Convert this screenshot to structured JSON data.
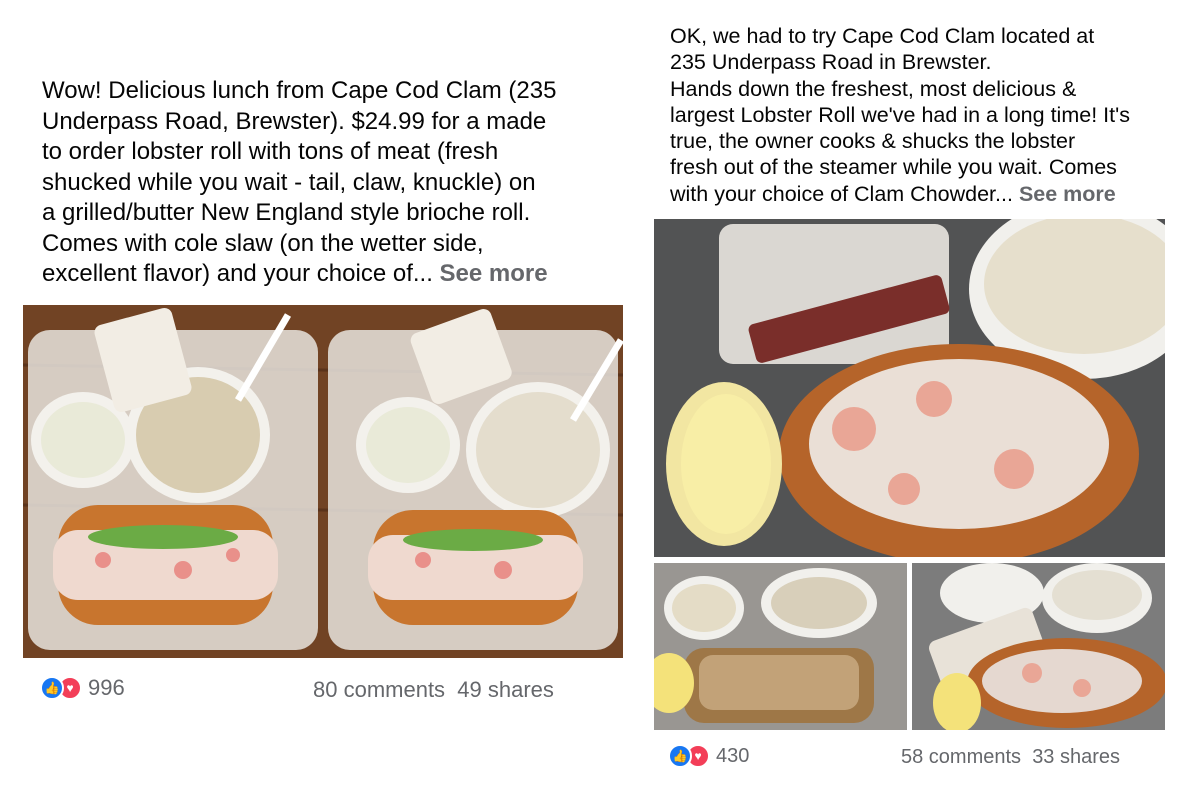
{
  "post1": {
    "text_lines": [
      "Wow! Delicious lunch from Cape Cod Clam (235",
      "Underpass Road, Brewster). $24.99 for a made",
      "to order lobster roll with tons of meat (fresh",
      "shucked while you wait - tail, claw, knuckle) on",
      "a grilled/butter New England style brioche roll.",
      "Comes with cole slaw (on the wetter side,",
      "excellent flavor) and your choice of..."
    ],
    "see_more": "See more",
    "reaction_count": "996",
    "comments": "80 comments",
    "shares": "49 shares"
  },
  "post2": {
    "text_lines": [
      "OK, we had to try Cape Cod Clam located at",
      "235 Underpass Road in Brewster.",
      "Hands down the freshest, most delicious &",
      "largest Lobster Roll we've had in a long time! It's",
      "true, the owner cooks & shucks the lobster",
      "fresh out of the steamer while you wait. Comes",
      "with your choice of Clam Chowder..."
    ],
    "see_more": "See more",
    "reaction_count": "430",
    "comments": "58 comments",
    "shares": "33 shares"
  },
  "icons": {
    "like": "thumbs-up-icon",
    "love": "heart-icon"
  },
  "colors": {
    "like_blue": "#1877f2",
    "love_red": "#f33e58",
    "secondary_text": "#65676b"
  }
}
